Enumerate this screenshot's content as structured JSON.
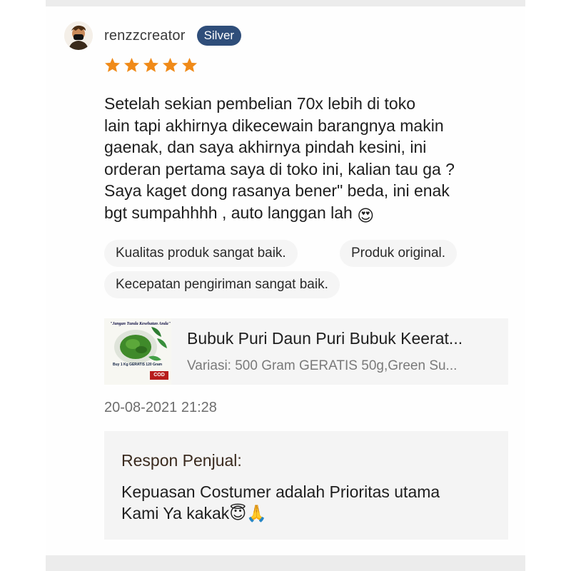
{
  "review": {
    "username": "renzzcreator",
    "badge": "Silver",
    "rating": 5,
    "rating_max": 5,
    "text": "Setelah sekian pembelian 70x lebih di toko\nlain tapi akhirnya dikecewain barangnya makin\ngaenak, dan saya akhirnya pindah kesini, ini\norderan pertama saya di toko ini, kalian tau ga ?\nSaya kaget dong rasanya bener\" beda, ini enak\nbgt sumpahhhh , auto langgan lah",
    "text_emoji": "😍",
    "tags": [
      "Kualitas produk sangat baik.",
      "Produk original.",
      "Kecepatan pengiriman sangat baik."
    ]
  },
  "product": {
    "title": "Bubuk Puri Daun Puri Bubuk Keerat...",
    "variant": "Variasi: 500 Gram GERATIS 50g,Green Su...",
    "thumb_top_text": "\"Jangan Tunda Kesehatan Anda\"",
    "thumb_bottom_text": "Buy 1 Kg GERATIS 120 Gram",
    "thumb_badge": "COD"
  },
  "timestamp": "20-08-2021 21:28",
  "seller_response": {
    "label": "Respon Penjual:",
    "text": "Kepuasan Costumer adalah Prioritas utama\nKami Ya kakak😇🙏"
  },
  "colors": {
    "badge_bg": "#2f4e7a",
    "star": "#f08a18",
    "chip_bg": "#f5f5f5",
    "seller_box_bg": "#f4f4f4"
  },
  "icons": {
    "avatar": "user-avatar",
    "star": "star-icon"
  }
}
